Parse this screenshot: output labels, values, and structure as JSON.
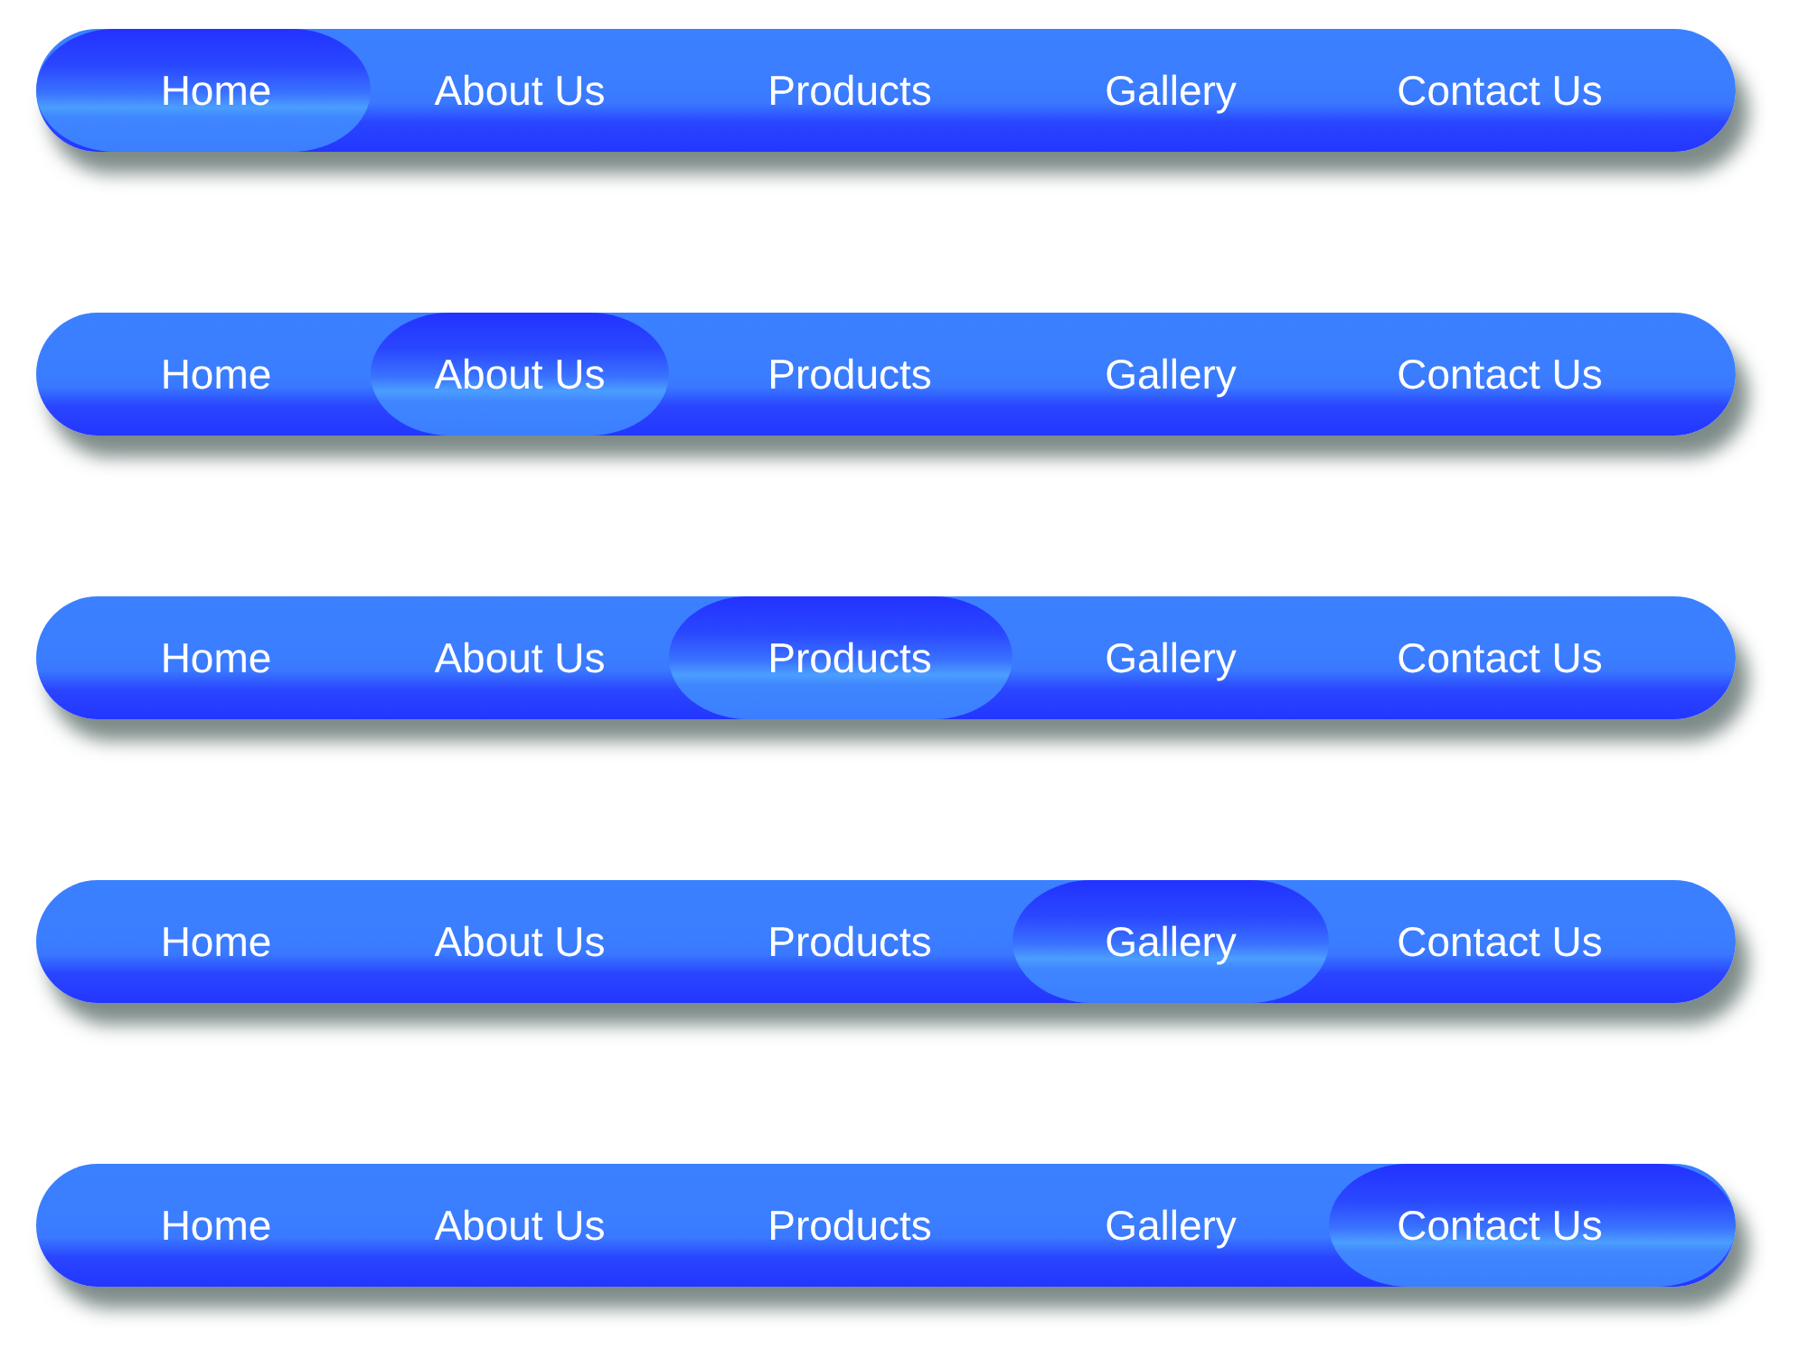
{
  "menus": [
    {
      "items": [
        {
          "label": "Home",
          "selected": true
        },
        {
          "label": "About Us",
          "selected": false
        },
        {
          "label": "Products",
          "selected": false
        },
        {
          "label": "Gallery",
          "selected": false
        },
        {
          "label": "Contact Us",
          "selected": false
        }
      ]
    },
    {
      "items": [
        {
          "label": "Home",
          "selected": false
        },
        {
          "label": "About Us",
          "selected": true
        },
        {
          "label": "Products",
          "selected": false
        },
        {
          "label": "Gallery",
          "selected": false
        },
        {
          "label": "Contact Us",
          "selected": false
        }
      ]
    },
    {
      "items": [
        {
          "label": "Home",
          "selected": false
        },
        {
          "label": "About Us",
          "selected": false
        },
        {
          "label": "Products",
          "selected": true
        },
        {
          "label": "Gallery",
          "selected": false
        },
        {
          "label": "Contact Us",
          "selected": false
        }
      ]
    },
    {
      "items": [
        {
          "label": "Home",
          "selected": false
        },
        {
          "label": "About Us",
          "selected": false
        },
        {
          "label": "Products",
          "selected": false
        },
        {
          "label": "Gallery",
          "selected": true
        },
        {
          "label": "Contact Us",
          "selected": false
        }
      ]
    },
    {
      "items": [
        {
          "label": "Home",
          "selected": false
        },
        {
          "label": "About Us",
          "selected": false
        },
        {
          "label": "Products",
          "selected": false
        },
        {
          "label": "Gallery",
          "selected": false
        },
        {
          "label": "Contact Us",
          "selected": true
        }
      ]
    }
  ]
}
